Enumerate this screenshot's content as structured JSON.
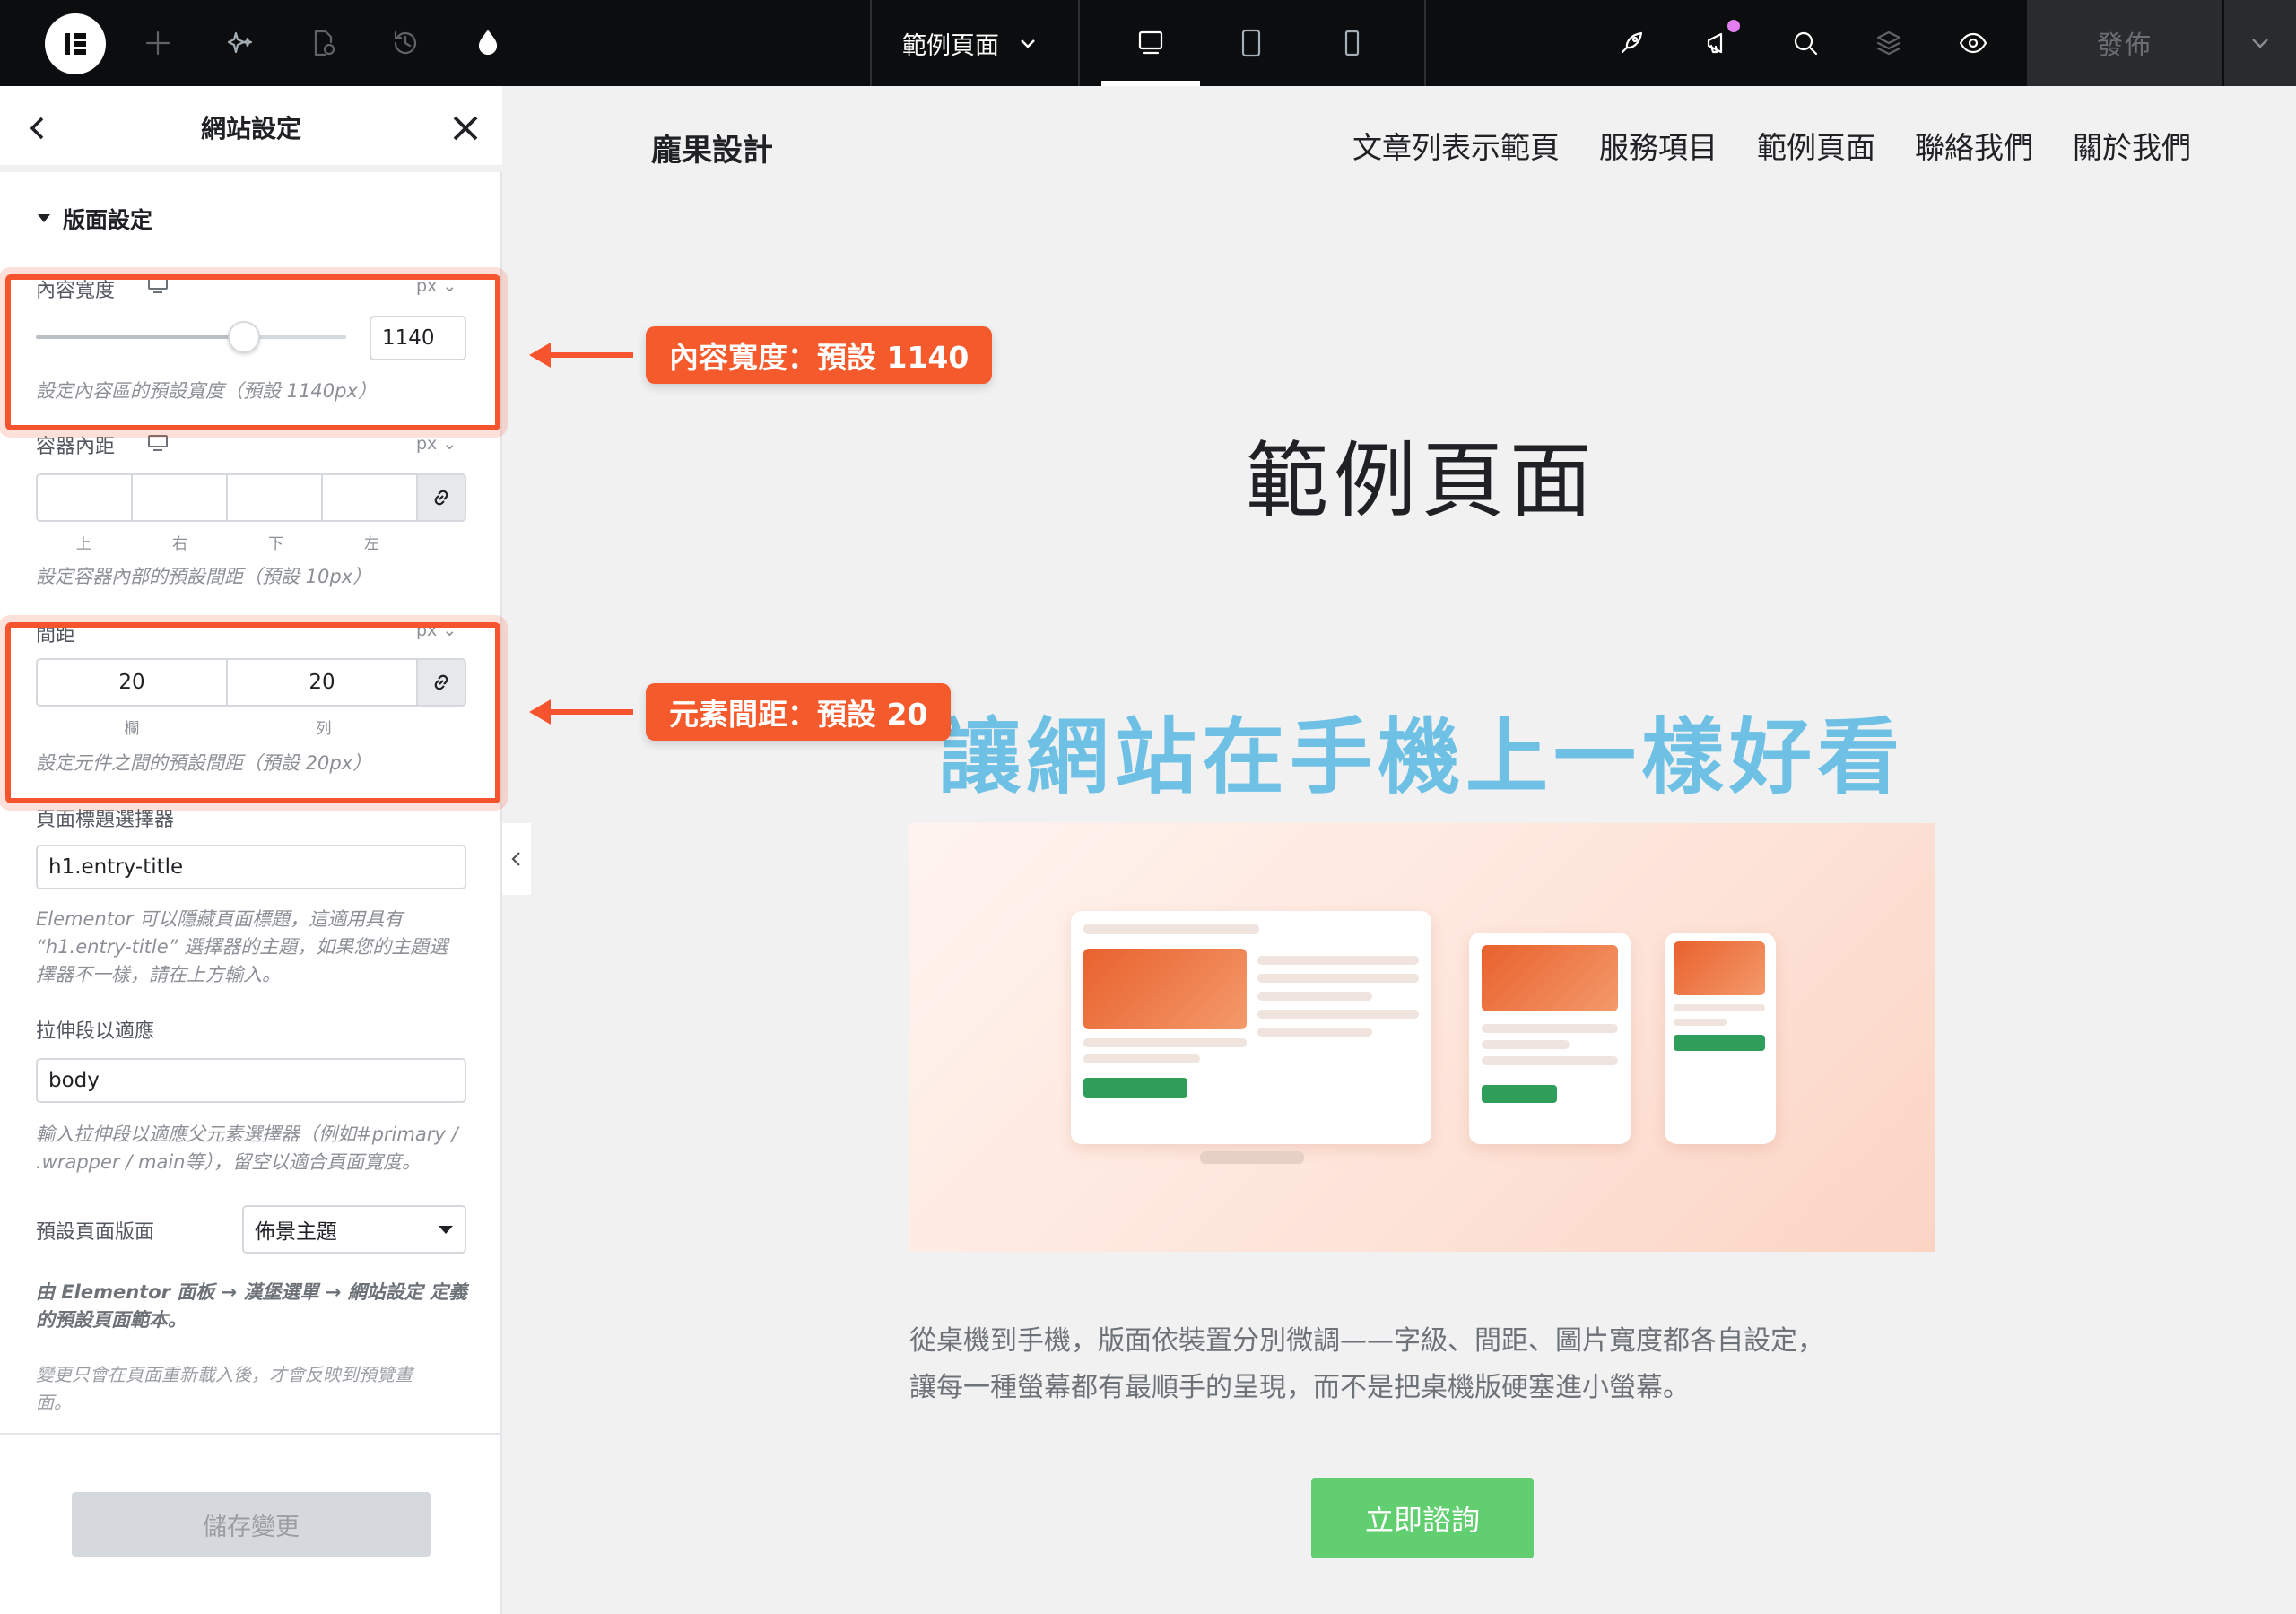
{
  "topbar": {
    "page_name": "範例頁面",
    "publish_label": "發佈",
    "icons": [
      "elementor-logo-icon",
      "add-icon",
      "ai-sparkle-icon",
      "page-settings-icon",
      "history-icon",
      "site-style-icon",
      "desktop-icon",
      "tablet-icon",
      "mobile-icon",
      "rocket-icon",
      "notifications-icon",
      "search-icon",
      "structure-icon",
      "preview-icon",
      "chevron-down-icon"
    ],
    "accent_dot_color": "#e47ef0"
  },
  "panel": {
    "title": "網站設定",
    "section_title": "版面設定",
    "content_width": {
      "label": "內容寬度",
      "unit": "px",
      "value": "1140",
      "slider_fraction": 0.67,
      "help": "設定內容區的預設寬度（預設 1140px）"
    },
    "container_padding": {
      "label": "容器內距",
      "unit": "px",
      "sides": [
        "上",
        "右",
        "下",
        "左"
      ],
      "help": "設定容器內部的預設間距（預設 10px）"
    },
    "gaps": {
      "label": "間距",
      "unit": "px",
      "column_value": "20",
      "row_value": "20",
      "column_label": "欄",
      "row_label": "列",
      "help": "設定元件之間的預設間距（預設 20px）"
    },
    "page_title_selector": {
      "label": "頁面標題選擇器",
      "value": "h1.entry-title",
      "help_line1": "Elementor 可以隱藏頁面標題，這適用具有",
      "help_line2": "“h1.entry-title” 選擇器的主題，如果您的主題選",
      "help_line3": "擇器不一樣，請在上方輸入。"
    },
    "stretch_section": {
      "label": "拉伸段以適應",
      "value": "body",
      "help_line1": "輸入拉伸段以適應父元素選擇器（例如#primary /",
      "help_line2": ".wrapper / main等），留空以適合頁面寬度。"
    },
    "default_layout": {
      "label": "預設頁面版面",
      "value": "佈景主題"
    },
    "layout_note_line1": "由 Elementor 面板 → 漢堡選單 → 網站設定 定義",
    "layout_note_line2": "的預設頁面範本。",
    "reload_note_line1": "變更只會在頁面重新載入後，才會反映到預覽畫",
    "reload_note_line2": "面。",
    "save_label": "儲存變更"
  },
  "callouts": {
    "content_width": "內容寬度：預設 1140",
    "gap": "元素間距：預設 20",
    "color": "#f55a2c"
  },
  "preview": {
    "site_title": "龐果設計",
    "nav": [
      "文章列表示範頁",
      "服務項目",
      "範例頁面",
      "聯絡我們",
      "關於我們"
    ],
    "page_heading": "範例頁面",
    "subheading": "讓網站在手機上一樣好看",
    "subheading_color": "#6ec1e4",
    "body_line1": "從桌機到手機，版面依裝置分別微調——字級、間距、圖片寬度都各自設定，",
    "body_line2": "讓每一種螢幕都有最順手的呈現，而不是把桌機版硬塞進小螢幕。",
    "cta_label": "立即諮詢",
    "cta_color": "#61ce70"
  }
}
